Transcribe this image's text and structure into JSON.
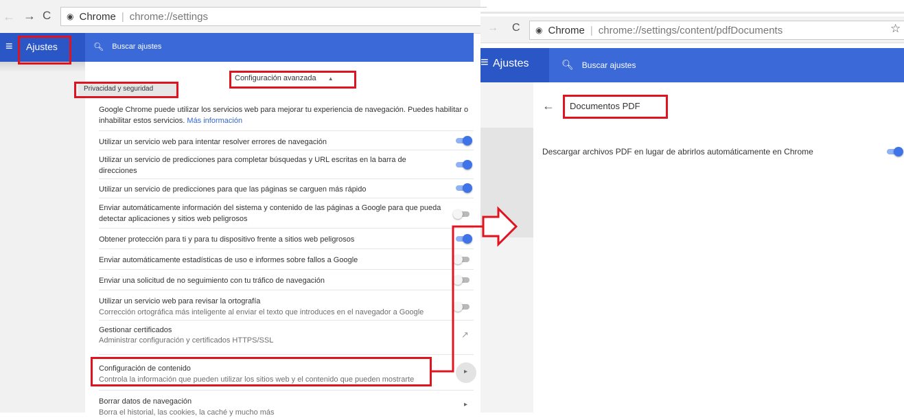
{
  "left": {
    "omnibox": {
      "site": "Chrome",
      "url": "chrome://settings"
    },
    "title": "Ajustes",
    "search_placeholder": "Buscar ajustes",
    "advanced_label": "Configuración avanzada",
    "section_title": "Privacidad y seguridad",
    "intro_text": "Google Chrome puede utilizar los servicios web para mejorar tu experiencia de navegación. Puedes habilitar o inhabilitar estos servicios.",
    "intro_link": "Más información",
    "rows": [
      {
        "title": "Utilizar un servicio web para intentar resolver errores de navegación",
        "state": "on"
      },
      {
        "title": "Utilizar un servicio de predicciones para completar búsquedas y URL escritas en la barra de direcciones",
        "state": "on"
      },
      {
        "title": "Utilizar un servicio de predicciones para que las páginas se carguen más rápido",
        "state": "on"
      },
      {
        "title": "Enviar automáticamente información del sistema y contenido de las páginas a Google para que pueda detectar aplicaciones y sitios web peligrosos",
        "state": "off"
      },
      {
        "title": "Obtener protección para ti y para tu dispositivo frente a sitios web peligrosos",
        "state": "on"
      },
      {
        "title": "Enviar automáticamente estadísticas de uso e informes sobre fallos a Google",
        "state": "off"
      },
      {
        "title": "Enviar una solicitud de no seguimiento con tu tráfico de navegación",
        "state": "off"
      },
      {
        "title": "Utilizar un servicio web para revisar la ortografía",
        "subtitle": "Corrección ortográfica más inteligente al enviar el texto que introduces en el navegador a Google",
        "state": "off"
      },
      {
        "title": "Gestionar certificados",
        "subtitle": "Administrar configuración y certificados HTTPS/SSL"
      },
      {
        "title": "Configuración de contenido",
        "subtitle": "Controla la información que pueden utilizar los sitios web y el contenido que pueden mostrarte"
      },
      {
        "title": "Borrar datos de navegación",
        "subtitle": "Borra el historial, las cookies, la caché y mucho más"
      }
    ]
  },
  "right": {
    "omnibox": {
      "site": "Chrome",
      "url": "chrome://settings/content/pdfDocuments"
    },
    "title": "Ajustes",
    "search_placeholder": "Buscar ajustes",
    "page_title": "Documentos PDF",
    "setting_label": "Descargar archivos PDF en lugar de abrirlos automáticamente en Chrome",
    "setting_state": "on"
  },
  "colors": {
    "accent_blue": "#2a56c6",
    "annotation_red": "#e0141e"
  }
}
